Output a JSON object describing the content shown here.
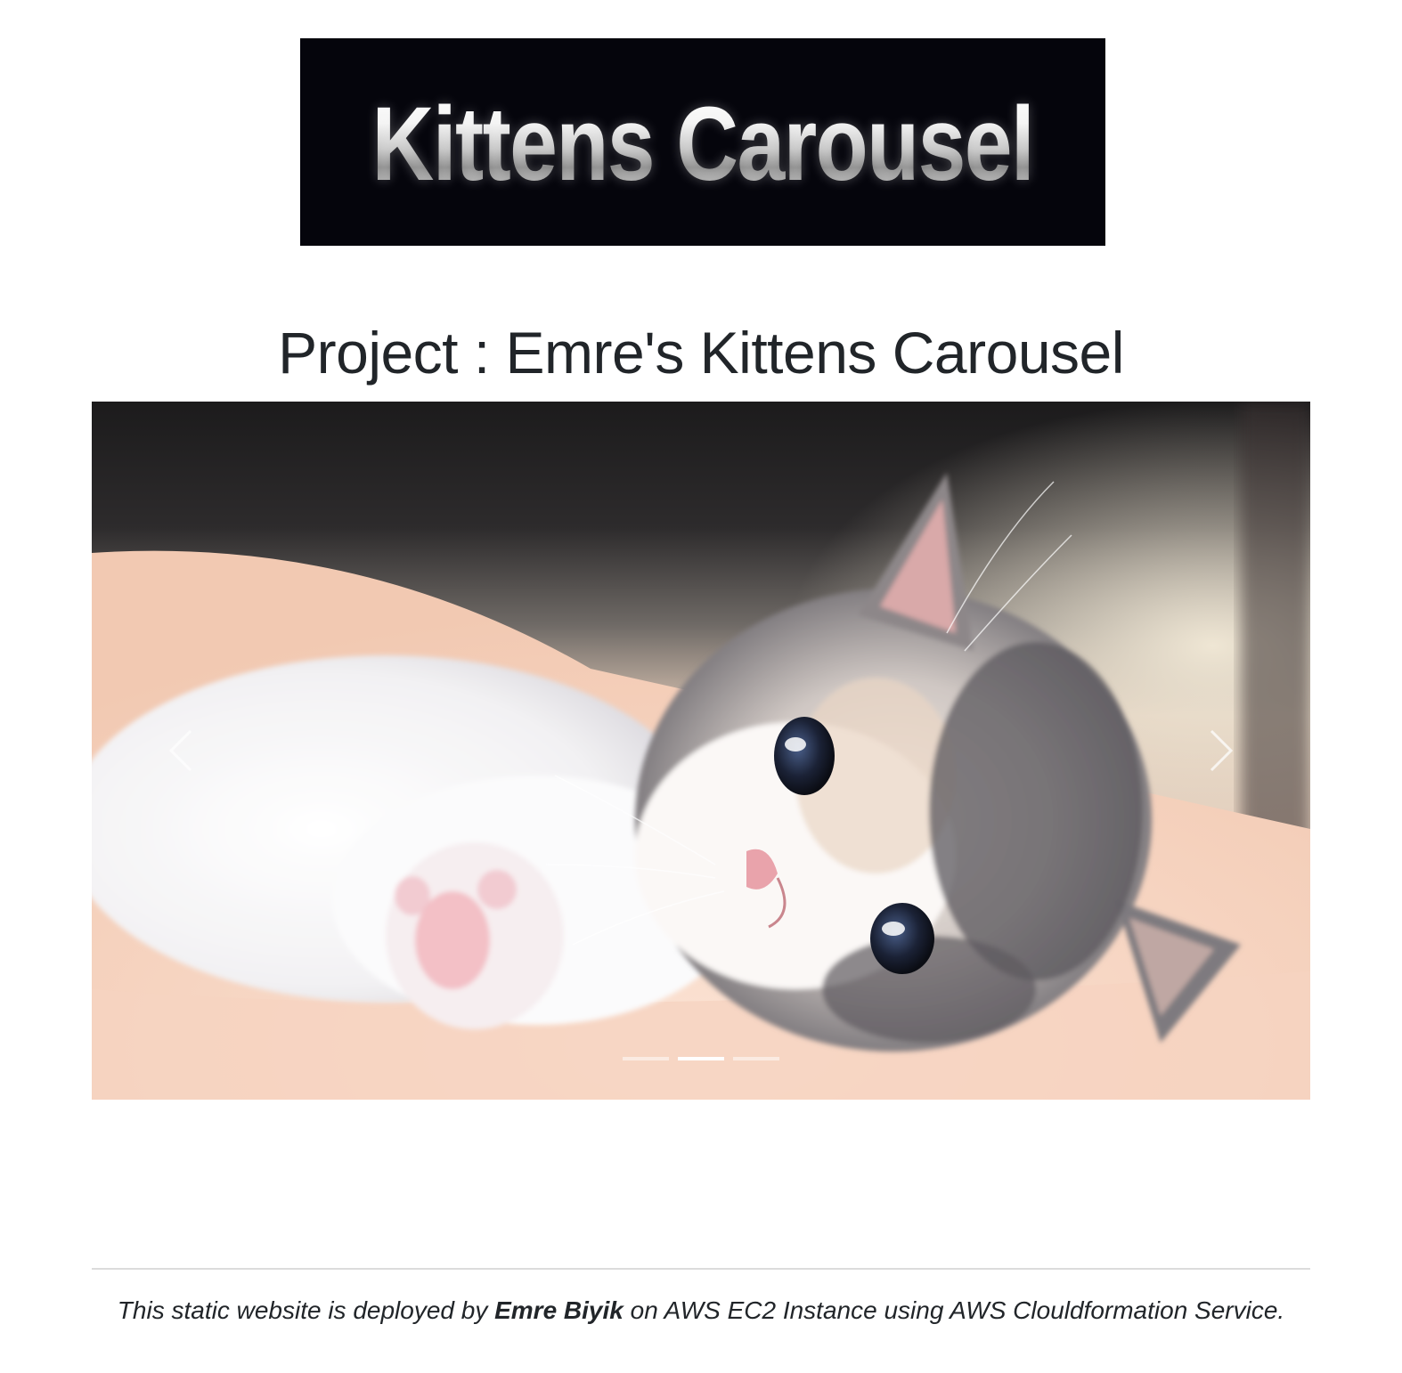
{
  "banner": {
    "text": "Kittens Carousel"
  },
  "header": {
    "title": "Project : Emre's Kittens Carousel"
  },
  "carousel": {
    "slide_count": 3,
    "active_index": 1,
    "prev_icon": "chevron-left-icon",
    "next_icon": "chevron-right-icon"
  },
  "footer": {
    "text_before": "This static website is deployed by ",
    "author": "Emre Biyik",
    "text_after": " on AWS EC2 Instance using AWS Clouldformation Service."
  }
}
